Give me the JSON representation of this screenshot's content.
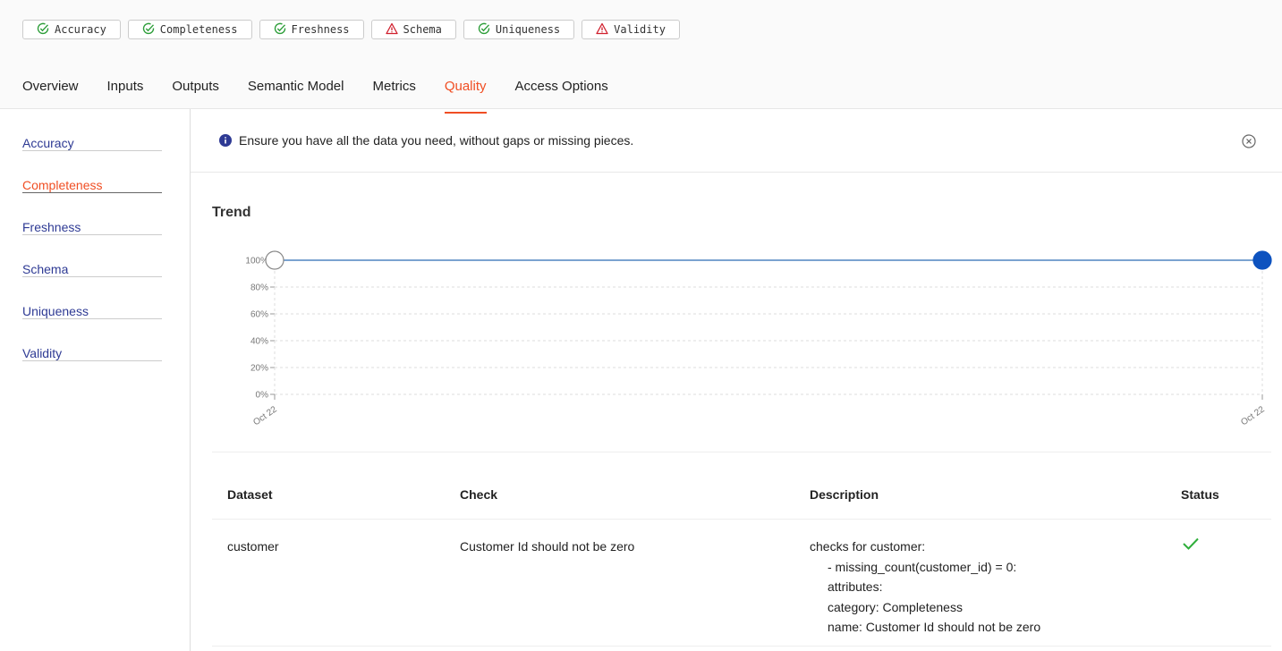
{
  "badges": [
    {
      "label": "Accuracy",
      "status": "pass",
      "icon": "check-circle-icon"
    },
    {
      "label": "Completeness",
      "status": "pass",
      "icon": "check-circle-icon"
    },
    {
      "label": "Freshness",
      "status": "pass",
      "icon": "check-circle-icon"
    },
    {
      "label": "Schema",
      "status": "warning",
      "icon": "warning-triangle-icon"
    },
    {
      "label": "Uniqueness",
      "status": "pass",
      "icon": "check-circle-icon"
    },
    {
      "label": "Validity",
      "status": "warning",
      "icon": "warning-triangle-icon"
    }
  ],
  "tabs": [
    {
      "label": "Overview"
    },
    {
      "label": "Inputs"
    },
    {
      "label": "Outputs"
    },
    {
      "label": "Semantic Model"
    },
    {
      "label": "Metrics"
    },
    {
      "label": "Quality",
      "active": true
    },
    {
      "label": "Access Options"
    }
  ],
  "sidebar": {
    "items": [
      {
        "label": "Accuracy"
      },
      {
        "label": "Completeness",
        "active": true
      },
      {
        "label": "Freshness"
      },
      {
        "label": "Schema"
      },
      {
        "label": "Uniqueness"
      },
      {
        "label": "Validity"
      }
    ]
  },
  "info": {
    "text": "Ensure you have all the data you need, without gaps or missing pieces."
  },
  "trend": {
    "title": "Trend"
  },
  "chart_data": {
    "type": "line",
    "x": [
      "Oct 22",
      "Oct 22"
    ],
    "values": [
      100,
      100
    ],
    "yticks": [
      "0%",
      "20%",
      "40%",
      "60%",
      "80%",
      "100%"
    ],
    "xticks": [
      "Oct 22",
      "Oct 22"
    ],
    "ylim": [
      0,
      100
    ],
    "grid": true
  },
  "table": {
    "headers": [
      "Dataset",
      "Check",
      "Description",
      "Status"
    ],
    "rows": [
      {
        "dataset": "customer",
        "check": "Customer Id should not be zero",
        "description": [
          "checks for customer:",
          "- missing_count(customer_id) = 0:",
          "attributes:",
          "category: Completeness",
          "name: Customer Id should not be zero"
        ],
        "status": "pass"
      }
    ]
  },
  "colors": {
    "accent": "#f04e23",
    "pass": "#2e9e3a",
    "warning": "#d0202e",
    "link": "#2e3a94",
    "series": "#7ba3d0",
    "point": "#0d52bf"
  }
}
